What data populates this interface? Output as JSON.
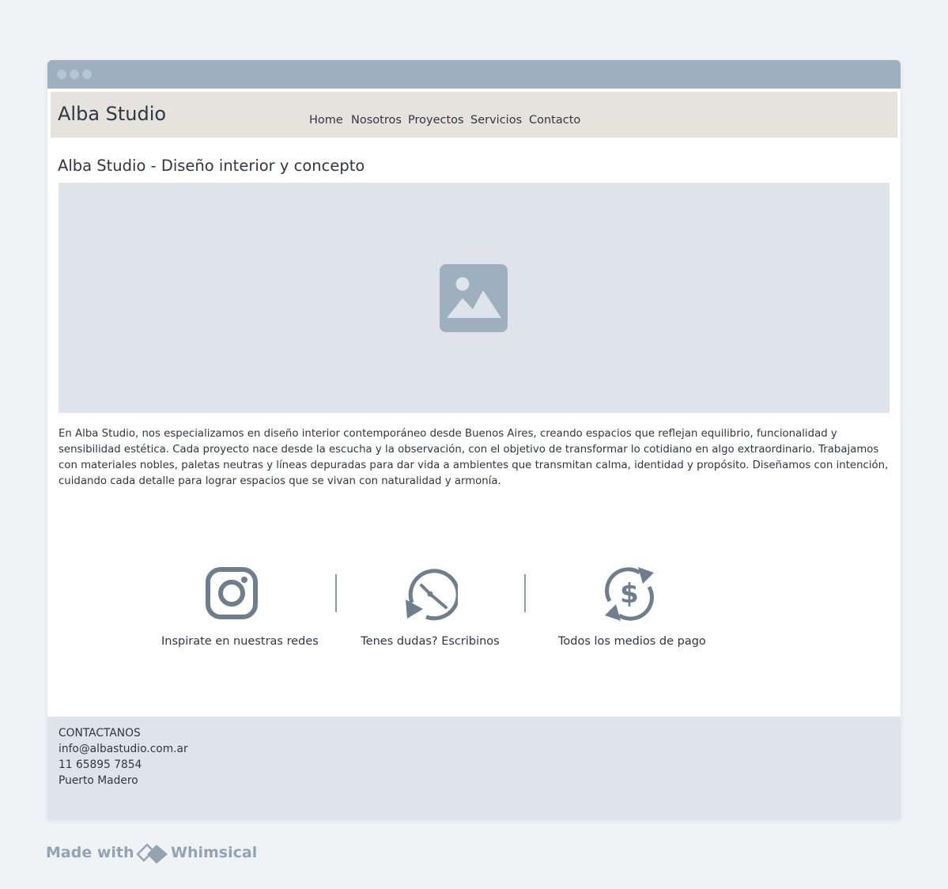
{
  "brand": {
    "name": "Alba Studio"
  },
  "nav": {
    "items": [
      "Home",
      "Nosotros",
      "Proyectos",
      "Servicios",
      "Contacto"
    ]
  },
  "page": {
    "title": "Alba Studio - Diseño interior y concepto",
    "hero_icon": "image-placeholder-icon",
    "description": "En Alba Studio, nos especializamos en diseño interior contemporáneo desde Buenos Aires, creando espacios que reflejan equilibrio, funcionalidad y sensibilidad estética. Cada proyecto nace desde la escucha y la observación, con el objetivo de transformar lo cotidiano en algo extraordinario. Trabajamos con materiales nobles, paletas neutras y líneas depuradas para dar vida a ambientes que transmitan calma, identidad y propósito. Diseñamos con intención, cuidando cada detalle para lograr espacios que se vivan con naturalidad y armonía."
  },
  "features": [
    {
      "icon": "instagram-icon",
      "label": "Inspirate en nuestras redes"
    },
    {
      "icon": "clock-icon",
      "label": "Tenes dudas? Escribinos"
    },
    {
      "icon": "dollar-exchange-icon",
      "label": "Todos los medios de pago"
    }
  ],
  "footer": {
    "heading": "CONTACTANOS",
    "email": "info@albastudio.com.ar",
    "phone": "11 65895 7854",
    "location": "Puerto Madero"
  },
  "watermark": {
    "prefix": "Made with",
    "brand": "Whimsical"
  },
  "colors": {
    "titlebar": "#9eafbd",
    "header_bg": "#e6e3df",
    "placeholder_bg": "#dfe3eb",
    "icon": "#6f7e8d",
    "text": "#2f3742"
  }
}
